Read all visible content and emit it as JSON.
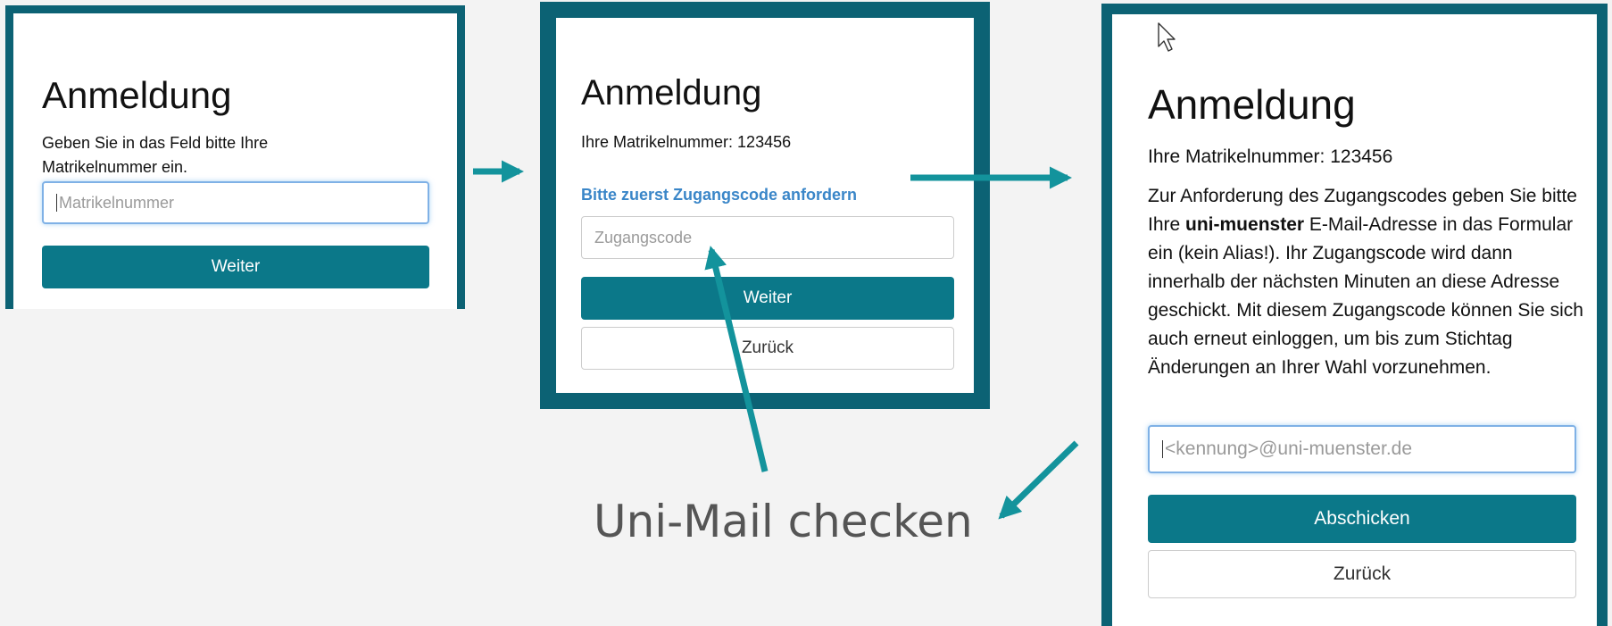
{
  "panel1": {
    "title": "Anmeldung",
    "instruction": "Geben Sie in das Feld bitte Ihre Matrikelnummer ein.",
    "input_placeholder": "Matrikelnummer",
    "continue_label": "Weiter"
  },
  "panel2": {
    "title": "Anmeldung",
    "student_id_text": "Ihre Matrikelnummer: 123456",
    "request_code_link": "Bitte zuerst Zugangscode anfordern",
    "input_placeholder": "Zugangscode",
    "continue_label": "Weiter",
    "back_label": "Zurück"
  },
  "panel3": {
    "title": "Anmeldung",
    "student_id_text": "Ihre Matrikelnummer: 123456",
    "info_before": "Zur Anforderung des Zugangscodes geben Sie bitte Ihre ",
    "info_bold": "uni-muenster",
    "info_after": " E-Mail-Adresse in das Formular ein (kein Alias!). Ihr Zugangscode wird dann innerhalb der nächsten Minuten an diese Adresse geschickt. Mit diesem Zugangscode können Sie sich auch erneut einloggen, um bis zum Stichtag Änderungen an Ihrer Wahl vorzunehmen.",
    "email_placeholder": "<kennung>@uni-muenster.de",
    "submit_label": "Abschicken",
    "back_label": "Zurück"
  },
  "caption": "Uni-Mail checken",
  "icons": {
    "cursor": "mouse-pointer-icon",
    "arrows": "arrow-icon"
  },
  "colors": {
    "frame": "#0c6274",
    "button_primary": "#0b7889",
    "arrow": "#13939c",
    "link": "#3a86c8",
    "background": "#f3f3f3"
  }
}
